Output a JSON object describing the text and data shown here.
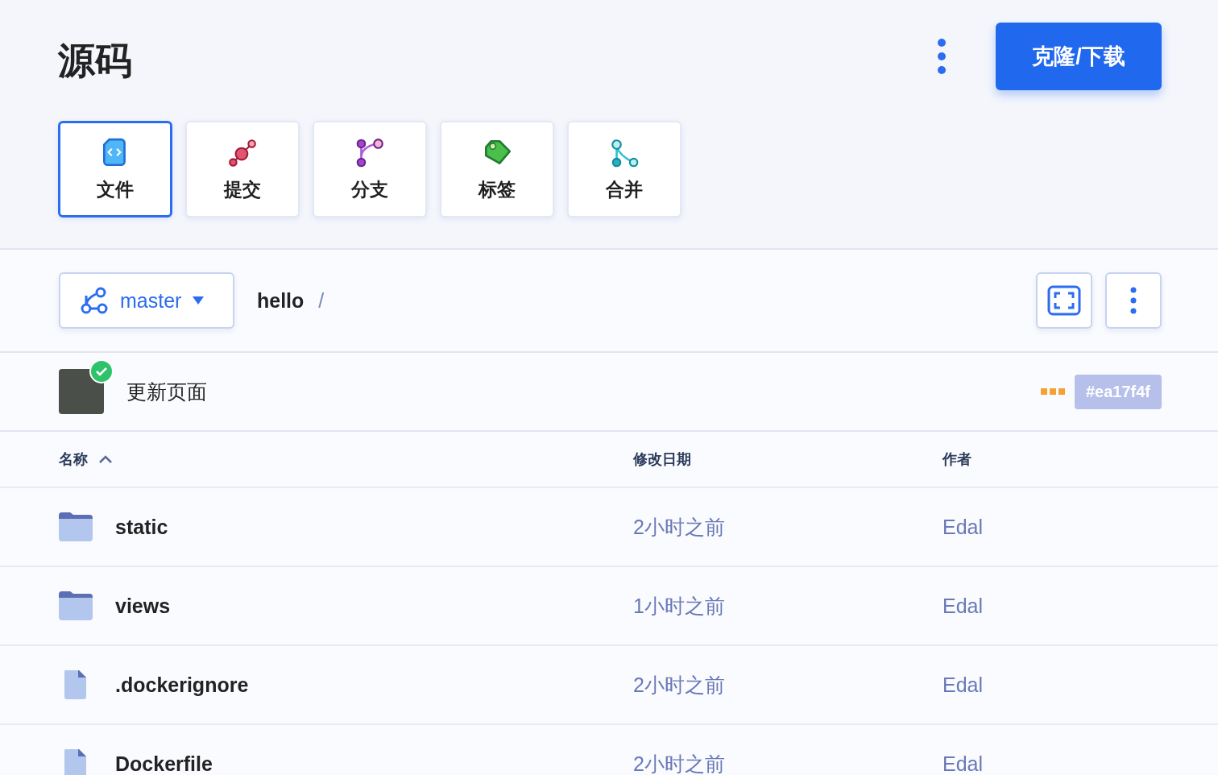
{
  "title": "源码",
  "clone_button": "克隆/下载",
  "tabs": [
    {
      "label": "文件",
      "kind": "files",
      "selected": true
    },
    {
      "label": "提交",
      "kind": "commits",
      "selected": false
    },
    {
      "label": "分支",
      "kind": "branches",
      "selected": false
    },
    {
      "label": "标签",
      "kind": "tags",
      "selected": false
    },
    {
      "label": "合并",
      "kind": "merges",
      "selected": false
    }
  ],
  "branch": "master",
  "path": "hello",
  "path_separator": "/",
  "commit": {
    "message": "更新页面",
    "verified": true,
    "hash": "#ea17f4f"
  },
  "table": {
    "columns": [
      {
        "label": "名称",
        "sorted": true
      },
      {
        "label": "修改日期",
        "sorted": false
      },
      {
        "label": "作者",
        "sorted": false
      }
    ],
    "rows": [
      {
        "kind": "folder",
        "name": "static",
        "date": "2小时之前",
        "author": "Edal"
      },
      {
        "kind": "folder",
        "name": "views",
        "date": "1小时之前",
        "author": "Edal"
      },
      {
        "kind": "file",
        "name": ".dockerignore",
        "date": "2小时之前",
        "author": "Edal"
      },
      {
        "kind": "file",
        "name": "Dockerfile",
        "date": "2小时之前",
        "author": "Edal"
      }
    ]
  }
}
